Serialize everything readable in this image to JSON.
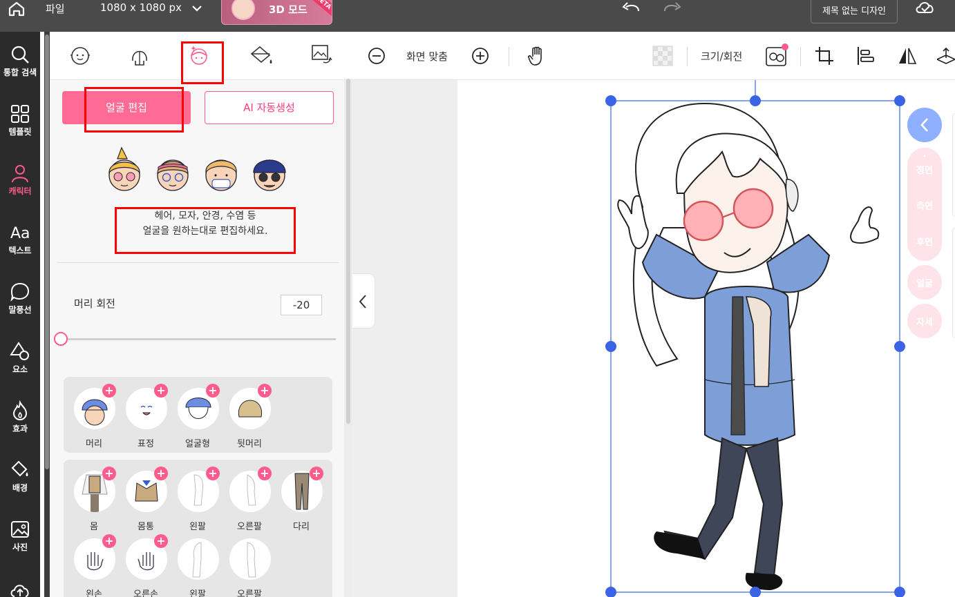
{
  "topbar": {
    "file_menu": "파일",
    "canvas_size": "1080 x 1080 px",
    "mode_3d_label": "3D 모드",
    "beta_badge": "BETA",
    "document_title": "제목 없는 디자인"
  },
  "rail": {
    "items": [
      {
        "label": "통합 검색",
        "icon": "search-icon"
      },
      {
        "label": "템플릿",
        "icon": "grid-icon"
      },
      {
        "label": "캐릭터",
        "icon": "person-icon",
        "active": true
      },
      {
        "label": "텍스트",
        "icon": "text-aa-icon"
      },
      {
        "label": "말풍선",
        "icon": "speech-bubble-icon"
      },
      {
        "label": "요소",
        "icon": "shapes-icon"
      },
      {
        "label": "효과",
        "icon": "flame-icon"
      },
      {
        "label": "배경",
        "icon": "paint-bucket-icon"
      },
      {
        "label": "사진",
        "icon": "image-icon"
      }
    ]
  },
  "panel": {
    "tabs": [
      "face-tab",
      "hair-back-tab",
      "face-edit-tab",
      "color-fill-tab",
      "image-swap-tab"
    ],
    "face_edit_button": "얼굴 편집",
    "ai_generate_button": "AI 자동생성",
    "description_line1": "헤어, 모자, 안경, 수염 등",
    "description_line2": "얼굴을 원하는대로 편집하세요.",
    "head_rotation_label": "머리 회전",
    "head_rotation_value": "-20",
    "head_rotation_slider_fraction": 0.0,
    "group1": [
      {
        "label": "머리"
      },
      {
        "label": "표정"
      },
      {
        "label": "얼굴형"
      },
      {
        "label": "뒷머리"
      }
    ],
    "group2_row1": [
      {
        "label": "몸"
      },
      {
        "label": "몸통"
      },
      {
        "label": "왼팔"
      },
      {
        "label": "오른팔"
      },
      {
        "label": "다리"
      }
    ],
    "group2_row2": [
      {
        "label": "왼손"
      },
      {
        "label": "오른손"
      },
      {
        "label": "왼팔"
      },
      {
        "label": "오른팔"
      }
    ]
  },
  "toolbar": {
    "fit_screen_label": "화면 맞춤",
    "size_rotate_label": "크기/회전"
  },
  "side": {
    "front": "정면",
    "side": "측면",
    "back": "후면",
    "face": "얼굴",
    "pose": "자세"
  },
  "colors": {
    "accent": "#ff5b8c",
    "rail_bg": "#2b2b2b",
    "topbar_bg": "#4a4a4a",
    "selection": "#3b63e6"
  }
}
